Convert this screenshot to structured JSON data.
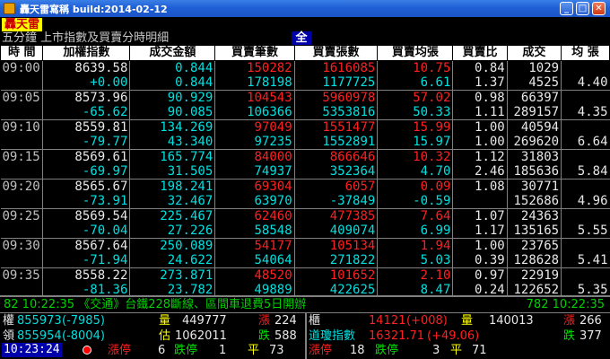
{
  "window": {
    "title": "轟天雷寫稱 build:2014-02-12"
  },
  "header": {
    "logo": "轟天雷",
    "subtitle": "五分鐘 上市指數及買賣分時明細",
    "all_button": "全"
  },
  "table": {
    "columns": [
      "時 間",
      "加權指數",
      "成交金額",
      "買賣筆數",
      "買賣張數",
      "買賣均張",
      "買賣比",
      "成交",
      "均 張"
    ],
    "groups": [
      {
        "time": "09:00",
        "index": "8639.58",
        "change": "+0.00",
        "amt1": "0.844",
        "amt2": "0.844",
        "cnt1": "150282",
        "cnt2": "178198",
        "vol1": "1616085",
        "vol2": "1177725",
        "avg1": "10.75",
        "avg2": "6.61",
        "ratio1": "0.84",
        "ratio2": "1.37",
        "deal1": "1029",
        "deal2": "4525",
        "per": "4.40"
      },
      {
        "time": "09:05",
        "index": "8573.96",
        "change": "-65.62",
        "amt1": "90.929",
        "amt2": "90.085",
        "cnt1": "104543",
        "cnt2": "106366",
        "vol1": "5960978",
        "vol2": "5353816",
        "avg1": "57.02",
        "avg2": "50.33",
        "ratio1": "0.98",
        "ratio2": "1.11",
        "deal1": "66397",
        "deal2": "289157",
        "per": "4.35"
      },
      {
        "time": "09:10",
        "index": "8559.81",
        "change": "-79.77",
        "amt1": "134.269",
        "amt2": "43.340",
        "cnt1": "97049",
        "cnt2": "97235",
        "vol1": "1551477",
        "vol2": "1552891",
        "avg1": "15.99",
        "avg2": "15.97",
        "ratio1": "1.00",
        "ratio2": "1.00",
        "deal1": "40594",
        "deal2": "269620",
        "per": "6.64"
      },
      {
        "time": "09:15",
        "index": "8569.61",
        "change": "-69.97",
        "amt1": "165.774",
        "amt2": "31.505",
        "cnt1": "84000",
        "cnt2": "74937",
        "vol1": "866646",
        "vol2": "352364",
        "avg1": "10.32",
        "avg2": "4.70",
        "ratio1": "1.12",
        "ratio2": "2.46",
        "deal1": "31803",
        "deal2": "185636",
        "per": "5.84"
      },
      {
        "time": "09:20",
        "index": "8565.67",
        "change": "-73.91",
        "amt1": "198.241",
        "amt2": "32.467",
        "cnt1": "69304",
        "cnt2": "63970",
        "vol1": "6057",
        "vol2": "-37849",
        "avg1": "0.09",
        "avg2": "-0.59",
        "ratio1": "1.08",
        "ratio2": "",
        "deal1": "30771",
        "deal2": "152686",
        "per": "4.96"
      },
      {
        "time": "09:25",
        "index": "8569.54",
        "change": "-70.04",
        "amt1": "225.467",
        "amt2": "27.226",
        "cnt1": "62460",
        "cnt2": "58548",
        "vol1": "477385",
        "vol2": "409074",
        "avg1": "7.64",
        "avg2": "6.99",
        "ratio1": "1.07",
        "ratio2": "1.17",
        "deal1": "24363",
        "deal2": "135165",
        "per": "5.55"
      },
      {
        "time": "09:30",
        "index": "8567.64",
        "change": "-71.94",
        "amt1": "250.089",
        "amt2": "24.622",
        "cnt1": "54177",
        "cnt2": "54064",
        "vol1": "105134",
        "vol2": "271822",
        "avg1": "1.94",
        "avg2": "5.03",
        "ratio1": "1.00",
        "ratio2": "0.39",
        "deal1": "23765",
        "deal2": "128628",
        "per": "5.41"
      },
      {
        "time": "09:35",
        "index": "8558.22",
        "change": "-81.36",
        "amt1": "273.871",
        "amt2": "23.782",
        "cnt1": "48520",
        "cnt2": "49889",
        "vol1": "101652",
        "vol2": "422625",
        "avg1": "2.10",
        "avg2": "8.47",
        "ratio1": "0.97",
        "ratio2": "0.24",
        "deal1": "22919",
        "deal2": "122652",
        "per": "5.35"
      }
    ]
  },
  "ticker": {
    "left": "82 10:22:35 《交通》台鐵228斷線、區間車退費5日開辦",
    "right": "782 10:22:35"
  },
  "status": {
    "left_row1": {
      "label": "權",
      "value": "855973",
      "change": "(-7985)",
      "vol_label": "量",
      "vol": "449777",
      "up_label": "漲",
      "up": "224"
    },
    "left_row2": {
      "label": "領",
      "value": "855954",
      "change": "(-8004)",
      "est_label": "估",
      "est": "1062011",
      "down_label": "跌",
      "down": "588"
    },
    "left_row3": {
      "time": "10:23:24",
      "limit_up_label": "漲停",
      "limit_up": "6",
      "limit_down_label": "跌停",
      "limit_down": "1",
      "flat_label": "平",
      "flat": "73"
    },
    "right_row1": {
      "label": "櫃",
      "value": "14121",
      "change": "(+008)",
      "vol_label": "量",
      "vol": "140013",
      "up_label": "漲",
      "up": "266"
    },
    "right_row2": {
      "label": "道瓊指數",
      "value": "16321.71",
      "change": "(+49.06)",
      "down_label": "跌",
      "down": "377"
    },
    "right_row3": {
      "limit_up_label": "漲停",
      "limit_up": "18",
      "limit_down_label": "跌停",
      "limit_down": "3",
      "flat_label": "平",
      "flat": "71"
    }
  }
}
